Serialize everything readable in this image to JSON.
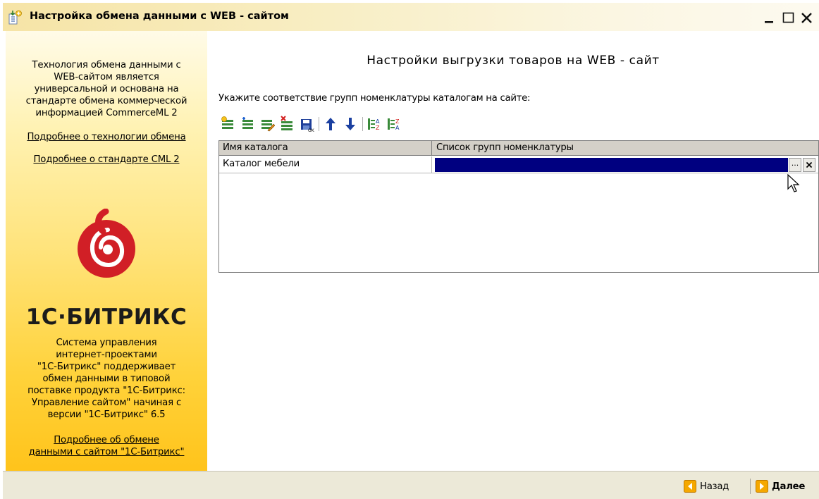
{
  "window": {
    "title": "Настройка обмена данными с WEB - сайтом",
    "icon": "import-export-icon",
    "controls": {
      "minimize": "minimize-icon",
      "maximize": "maximize-icon",
      "close": "close-icon"
    }
  },
  "sidebar": {
    "intro_lines": [
      "Технология обмена данными с",
      "WEB-сайтом является",
      "универсальной и основана на",
      "стандарте обмена коммерческой",
      "информацией CommerceML 2"
    ],
    "link_technology": "Подробнее о технологии обмена",
    "link_cml": "Подробнее о стандарте CML 2",
    "brand": "1С·БИТРИКС",
    "description_lines": [
      "Система управления",
      "интернет-проектами",
      "\"1С-Битрикс\" поддерживает",
      "обмен данными в типовой",
      "поставке продукта \"1С-Битрикс:",
      "Управление сайтом\" начиная с",
      "версии \"1С-Битрикс\" 6.5"
    ],
    "link_bitrix_lines": [
      "Подробнее об обмене",
      "данными с сайтом \"1С-Битрикс\""
    ],
    "colors": {
      "gradient_top": "#fffbe8",
      "gradient_bottom": "#ffc31a",
      "logo_red": "#d11f26"
    }
  },
  "main": {
    "title": "Настройки выгрузки товаров на WEB - сайт",
    "instruction": "Укажите соответствие групп номенклатуры каталогам на сайте:",
    "toolbar": [
      "add-row-icon",
      "copy-row-icon",
      "edit-row-icon",
      "delete-row-icon",
      "end-edit-icon",
      "move-up-icon",
      "move-down-icon",
      "sort-ascending-icon",
      "sort-descending-icon"
    ],
    "table": {
      "columns": [
        "Имя каталога",
        "Список групп номенклатуры"
      ],
      "rows": [
        {
          "catalog_name": "Каталог мебели",
          "groups": ""
        }
      ],
      "pick_button": "...",
      "selection_color": "#000080"
    }
  },
  "footer": {
    "back_label": "Назад",
    "next_label": "Далее",
    "arrow_color": "#f5a800"
  }
}
